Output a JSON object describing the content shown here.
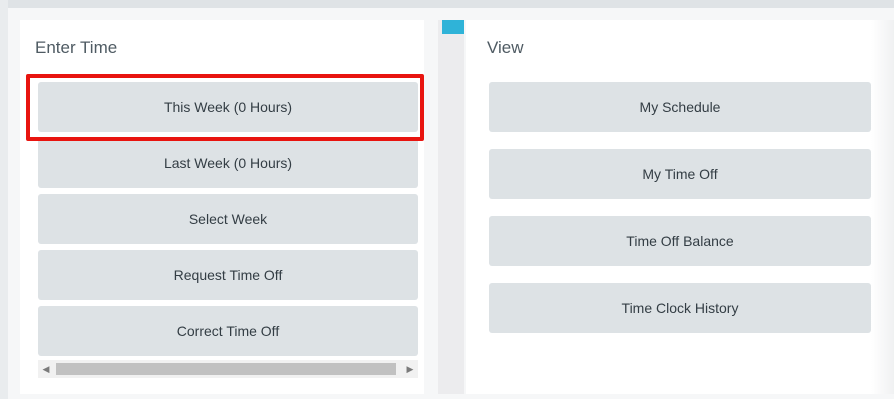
{
  "enter_time": {
    "title": "Enter Time",
    "buttons": [
      {
        "label": "This Week (0 Hours)"
      },
      {
        "label": "Last Week (0 Hours)"
      },
      {
        "label": "Select Week"
      },
      {
        "label": "Request Time Off"
      },
      {
        "label": "Correct Time Off"
      }
    ]
  },
  "view": {
    "title": "View",
    "buttons": [
      {
        "label": "My Schedule"
      },
      {
        "label": "My Time Off"
      },
      {
        "label": "Time Off Balance"
      },
      {
        "label": "Time Clock History"
      }
    ]
  },
  "scrollbar": {
    "left_arrow_icon": "scroll-left-arrow-icon",
    "right_arrow_icon": "scroll-right-arrow-icon"
  },
  "colors": {
    "highlight": "#e8140f",
    "accent": "#2fb3d8",
    "button_bg": "#dde2e5"
  }
}
